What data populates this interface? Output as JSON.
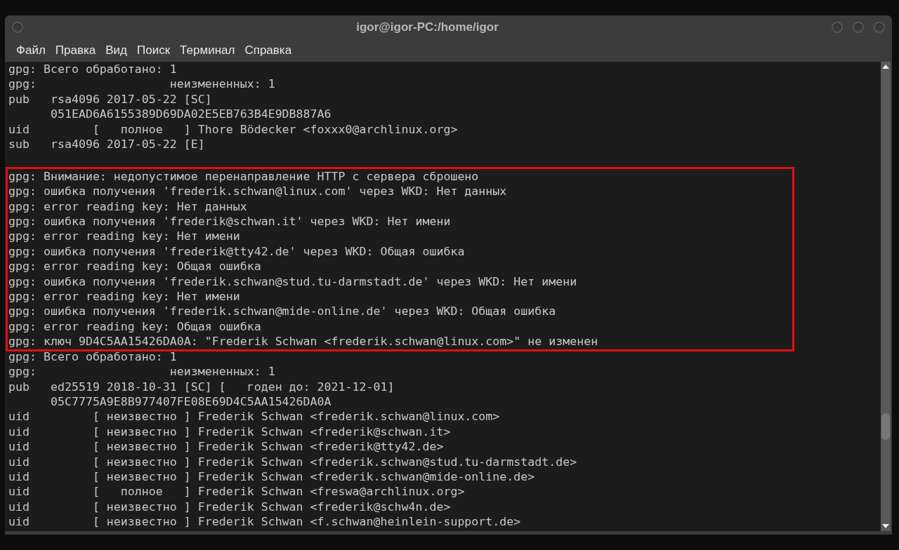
{
  "window": {
    "title": "igor@igor-PC:/home/igor"
  },
  "menu": [
    "Файл",
    "Правка",
    "Вид",
    "Поиск",
    "Терминал",
    "Справка"
  ],
  "terminal": {
    "sections": [
      {
        "highlighted": false,
        "lines": [
          "gpg: Всего обработано: 1",
          "gpg:                   неизмененных: 1",
          "pub   rsa4096 2017-05-22 [SC]",
          "      051EAD6A6155389D69DA02E5EB763B4E9DB887A6",
          "uid         [   полное   ] Thore Bödecker <foxxx0@archlinux.org>",
          "sub   rsa4096 2017-05-22 [E]"
        ]
      },
      {
        "highlighted": true,
        "lines": [
          "gpg: Внимание: недопустимое перенаправление HTTP с сервера сброшено",
          "gpg: ошибка получения 'frederik.schwan@linux.com' через WKD: Нет данных",
          "gpg: error reading key: Нет данных",
          "gpg: ошибка получения 'frederik@schwan.it' через WKD: Нет имени",
          "gpg: error reading key: Нет имени",
          "gpg: ошибка получения 'frederik@tty42.de' через WKD: Общая ошибка",
          "gpg: error reading key: Общая ошибка",
          "gpg: ошибка получения 'frederik.schwan@stud.tu-darmstadt.de' через WKD: Нет имени",
          "gpg: error reading key: Нет имени",
          "gpg: ошибка получения 'frederik.schwan@mide-online.de' через WKD: Общая ошибка",
          "gpg: error reading key: Общая ошибка",
          "gpg: ключ 9D4C5AA15426DA0A: \"Frederik Schwan <frederik.schwan@linux.com>\" не изменен"
        ]
      },
      {
        "highlighted": false,
        "lines": [
          "gpg: Всего обработано: 1",
          "gpg:                   неизмененных: 1",
          "pub   ed25519 2018-10-31 [SC] [   годен до: 2021-12-01]",
          "      05C7775A9E8B977407FE08E69D4C5AA15426DA0A",
          "uid         [ неизвестно ] Frederik Schwan <frederik.schwan@linux.com>",
          "uid         [ неизвестно ] Frederik Schwan <frederik@schwan.it>",
          "uid         [ неизвестно ] Frederik Schwan <frederik@tty42.de>",
          "uid         [ неизвестно ] Frederik Schwan <frederik.schwan@stud.tu-darmstadt.de>",
          "uid         [ неизвестно ] Frederik Schwan <frederik.schwan@mide-online.de>",
          "uid         [   полное   ] Frederik Schwan <freswa@archlinux.org>",
          "uid         [ неизвестно ] Frederik Schwan <frederik@schw4n.de>",
          "uid         [ неизвестно ] Frederik Schwan <f.schwan@heinlein-support.de>"
        ]
      }
    ]
  }
}
